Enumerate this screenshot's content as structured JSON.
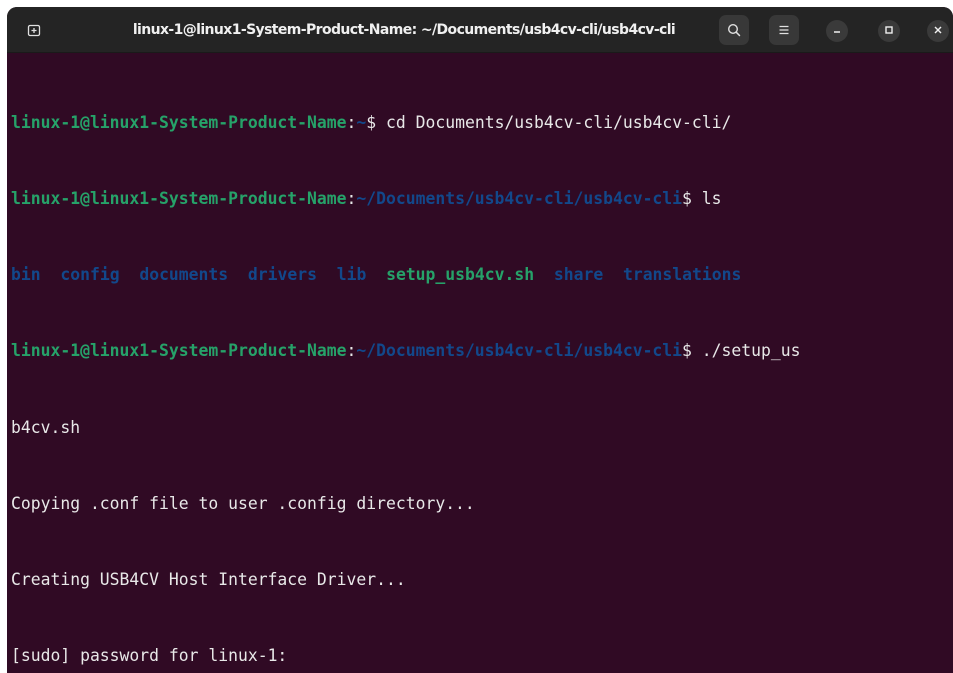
{
  "window": {
    "title": "linux-1@linux1-System-Product-Name: ~/Documents/usb4cv-cli/usb4cv-cli"
  },
  "titlebar": {
    "icons": [
      "new-tab-icon",
      "search-icon",
      "hamburger-menu-icon",
      "minimize-icon",
      "maximize-icon",
      "close-icon"
    ]
  },
  "colors": {
    "background": "#300a24",
    "titlebar": "#242424",
    "prompt_user": "#26a269",
    "path": "#12488b",
    "directory": "#12488b",
    "executable": "#26a269",
    "text": "#e8e8e8"
  },
  "terminal": {
    "line1": {
      "user": "linux-1@linux1-System-Product-Name",
      "sep": ":",
      "path": "~",
      "dollar": "$ ",
      "command": "cd Documents/usb4cv-cli/usb4cv-cli/"
    },
    "line2": {
      "user": "linux-1@linux1-System-Product-Name",
      "sep": ":",
      "path": "~/Documents/usb4cv-cli/usb4cv-cli",
      "dollar": "$ ",
      "command": "ls"
    },
    "ls_output": {
      "entries": [
        {
          "name": "bin",
          "type": "dir"
        },
        {
          "name": "config",
          "type": "dir"
        },
        {
          "name": "documents",
          "type": "dir"
        },
        {
          "name": "drivers",
          "type": "dir"
        },
        {
          "name": "lib",
          "type": "dir"
        },
        {
          "name": "setup_usb4cv.sh",
          "type": "exe"
        },
        {
          "name": "share",
          "type": "dir"
        },
        {
          "name": "translations",
          "type": "dir"
        }
      ]
    },
    "line4": {
      "user": "linux-1@linux1-System-Product-Name",
      "sep": ":",
      "path": "~/Documents/usb4cv-cli/usb4cv-cli",
      "dollar": "$ ",
      "command": "./setup_us"
    },
    "line5": "b4cv.sh",
    "line6": "Copying .conf file to user .config directory...",
    "line7": "Creating USB4CV Host Interface Driver...",
    "line8": "[sudo] password for linux-1: "
  }
}
